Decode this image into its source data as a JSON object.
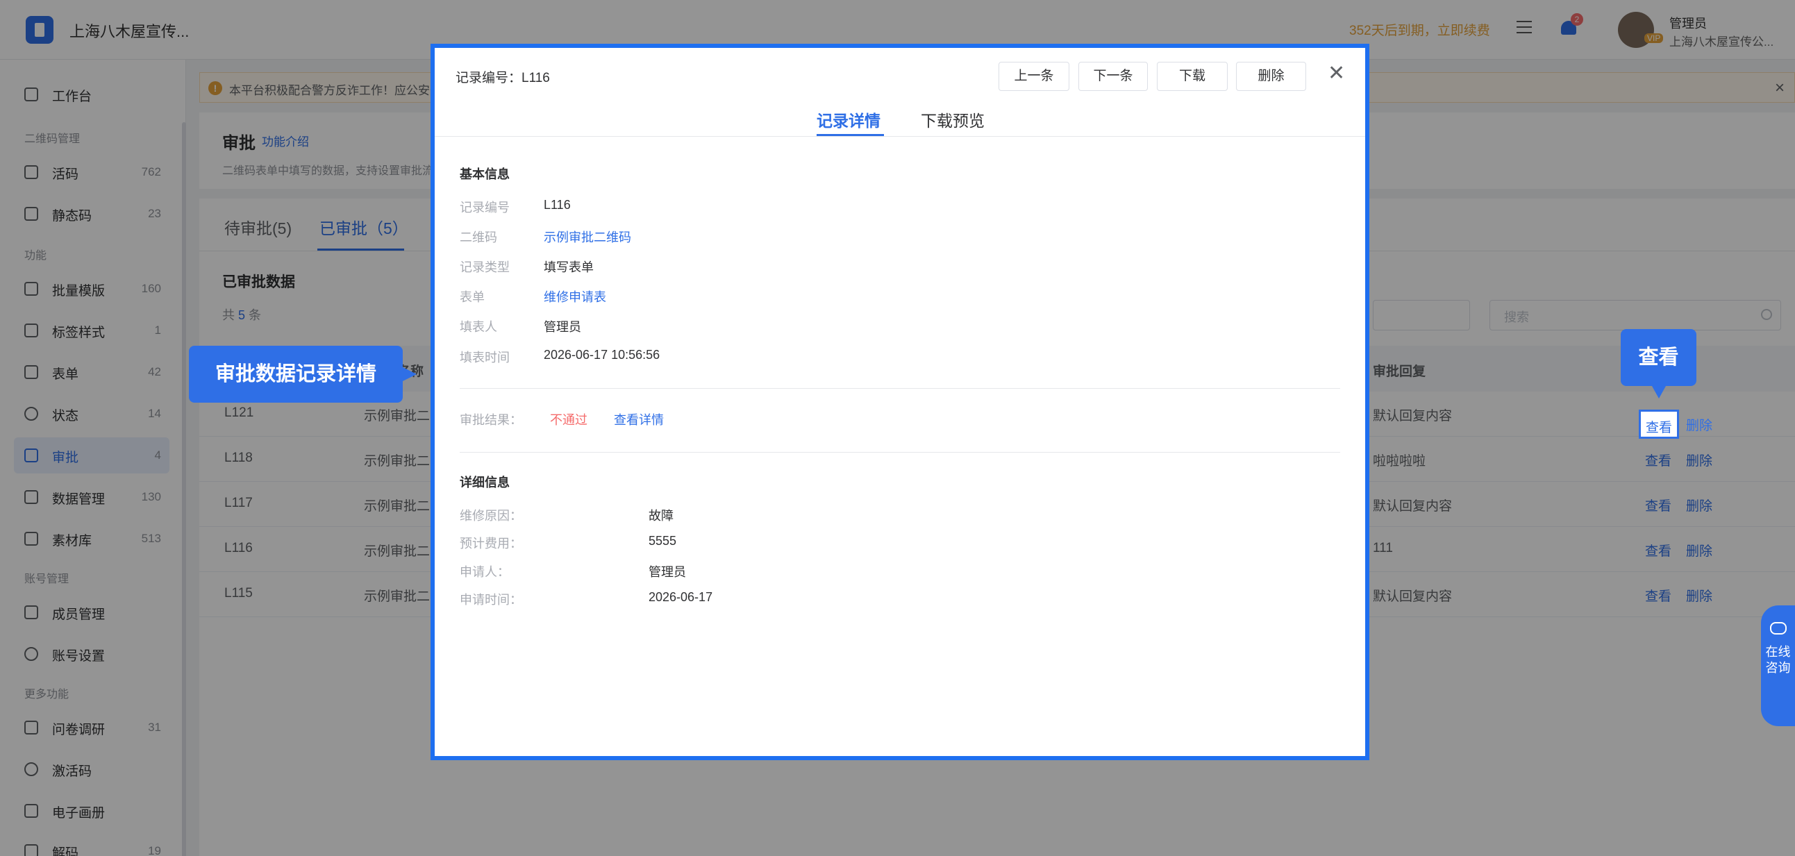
{
  "app": {
    "title": "上海八木屋宣传...",
    "expire_text": "352天后到期，立即续费",
    "notification_count": "2",
    "user_role": "管理员",
    "user_org": "上海八木屋宣传公...",
    "vip": "VIP"
  },
  "sidebar": {
    "groups": {
      "qr": "二维码管理",
      "func": "功能",
      "account": "账号管理",
      "more": "更多功能"
    },
    "items": [
      {
        "label": "工作台",
        "count": ""
      },
      {
        "label": "活码",
        "count": "762"
      },
      {
        "label": "静态码",
        "count": "23"
      },
      {
        "label": "批量模版",
        "count": "160"
      },
      {
        "label": "标签样式",
        "count": "1"
      },
      {
        "label": "表单",
        "count": "42"
      },
      {
        "label": "状态",
        "count": "14"
      },
      {
        "label": "审批",
        "count": "4"
      },
      {
        "label": "数据管理",
        "count": "130"
      },
      {
        "label": "素材库",
        "count": "513"
      },
      {
        "label": "成员管理",
        "count": ""
      },
      {
        "label": "账号设置",
        "count": ""
      },
      {
        "label": "问卷调研",
        "count": "31"
      },
      {
        "label": "激活码",
        "count": ""
      },
      {
        "label": "电子画册",
        "count": ""
      },
      {
        "label": "解码",
        "count": "19"
      }
    ]
  },
  "notice": {
    "text": "本平台积极配合警方反诈工作！应公安部"
  },
  "page": {
    "title": "审批",
    "intro_link": "功能介绍",
    "desc": "二维码表单中填写的数据，支持设置审批流"
  },
  "tabs": [
    {
      "label": "待审批(5)"
    },
    {
      "label": "已审批（5）"
    }
  ],
  "list": {
    "section_title": "已审批数据",
    "total_prefix": "共",
    "total_count": "5",
    "total_suffix": "条",
    "search_placeholder": "搜索",
    "headers": {
      "name": "名称",
      "reply": "审批回复"
    },
    "rows": [
      {
        "id": "L121",
        "name": "示例审批二",
        "reply": "默认回复内容",
        "view": "查看",
        "delete": "删除"
      },
      {
        "id": "L118",
        "name": "示例审批二",
        "reply": "啦啦啦啦",
        "view": "查看",
        "delete": "删除"
      },
      {
        "id": "L117",
        "name": "示例审批二",
        "reply": "默认回复内容",
        "view": "查看",
        "delete": "删除"
      },
      {
        "id": "L116",
        "name": "示例审批二",
        "reply": "111",
        "view": "查看",
        "delete": "删除"
      },
      {
        "id": "L115",
        "name": "示例审批二",
        "reply": "默认回复内容",
        "view": "查看",
        "delete": "删除"
      }
    ]
  },
  "callouts": {
    "left": "审批数据记录详情",
    "right": "查看"
  },
  "float": {
    "consult": "在线咨询"
  },
  "modal": {
    "record_no": "记录编号：L116",
    "buttons": {
      "prev": "上一条",
      "next": "下一条",
      "download": "下载",
      "delete": "删除"
    },
    "tabs": {
      "detail": "记录详情",
      "preview": "下载预览"
    },
    "basic_title": "基本信息",
    "basic": [
      {
        "label": "记录编号",
        "value": "L116"
      },
      {
        "label": "二维码",
        "value": "示例审批二维码"
      },
      {
        "label": "记录类型",
        "value": "填写表单"
      },
      {
        "label": "表单",
        "value": "维修申请表"
      },
      {
        "label": "填表人",
        "value": "管理员"
      },
      {
        "label": "填表时间",
        "value": "2026-06-17 10:56:56"
      }
    ],
    "result_label": "审批结果：",
    "result_value": "不通过",
    "result_link": "查看详情",
    "detail_title": "详细信息",
    "details": [
      {
        "label": "维修原因：",
        "value": "故障"
      },
      {
        "label": "预计费用：",
        "value": "5555"
      },
      {
        "label": "申请人：",
        "value": "管理员"
      },
      {
        "label": "申请时间：",
        "value": "2026-06-17"
      }
    ]
  },
  "colors": {
    "accent": "#2f6fe6",
    "danger": "#f56c6c",
    "warning": "#e6a23c"
  }
}
